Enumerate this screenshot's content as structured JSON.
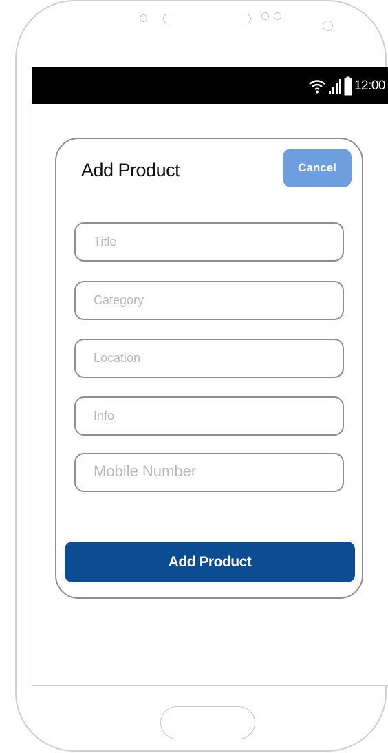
{
  "status_bar": {
    "time": "12:00",
    "icons": [
      "wifi-icon",
      "signal-icon",
      "battery-icon"
    ]
  },
  "form": {
    "title": "Add Product",
    "cancel_label": "Cancel",
    "fields": [
      {
        "placeholder": "Title"
      },
      {
        "placeholder": "Category"
      },
      {
        "placeholder": "Location"
      },
      {
        "placeholder": "Info"
      },
      {
        "placeholder": "Mobile Number"
      }
    ],
    "submit_label": "Add Product"
  },
  "colors": {
    "cancel_button": "#6f9ede",
    "submit_button": "#0b4c93",
    "status_bar": "#000000"
  }
}
